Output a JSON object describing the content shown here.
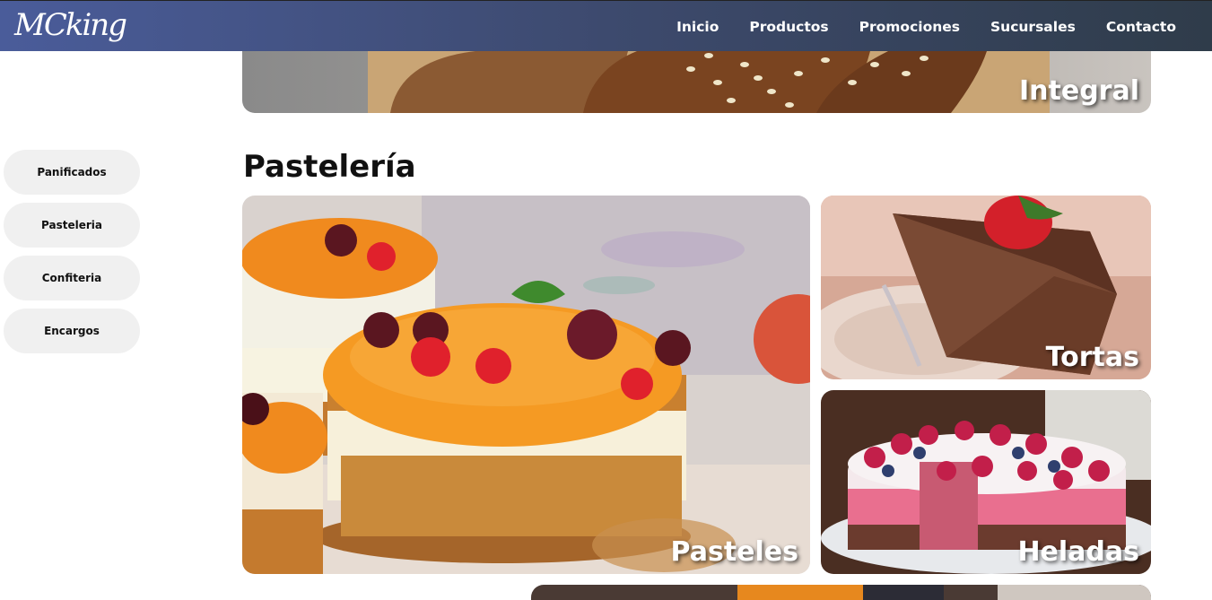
{
  "header": {
    "logo_text": "MCking",
    "nav": [
      {
        "label": "Inicio"
      },
      {
        "label": "Productos"
      },
      {
        "label": "Promociones"
      },
      {
        "label": "Sucursales"
      },
      {
        "label": "Contacto"
      }
    ]
  },
  "sidebar": {
    "items": [
      {
        "label": "Panificados"
      },
      {
        "label": "Pasteleria"
      },
      {
        "label": "Confiteria"
      },
      {
        "label": "Encargos"
      }
    ]
  },
  "main": {
    "top_tile_label": "Integral",
    "section_title": "Pastelería",
    "tiles": [
      {
        "label": "Pasteles"
      },
      {
        "label": "Tortas"
      },
      {
        "label": "Heladas"
      }
    ]
  },
  "colors": {
    "header_gradient_start": "#4a5c9a",
    "header_gradient_end": "#2f3c4a",
    "sidebar_button": "#f0f0f0"
  }
}
